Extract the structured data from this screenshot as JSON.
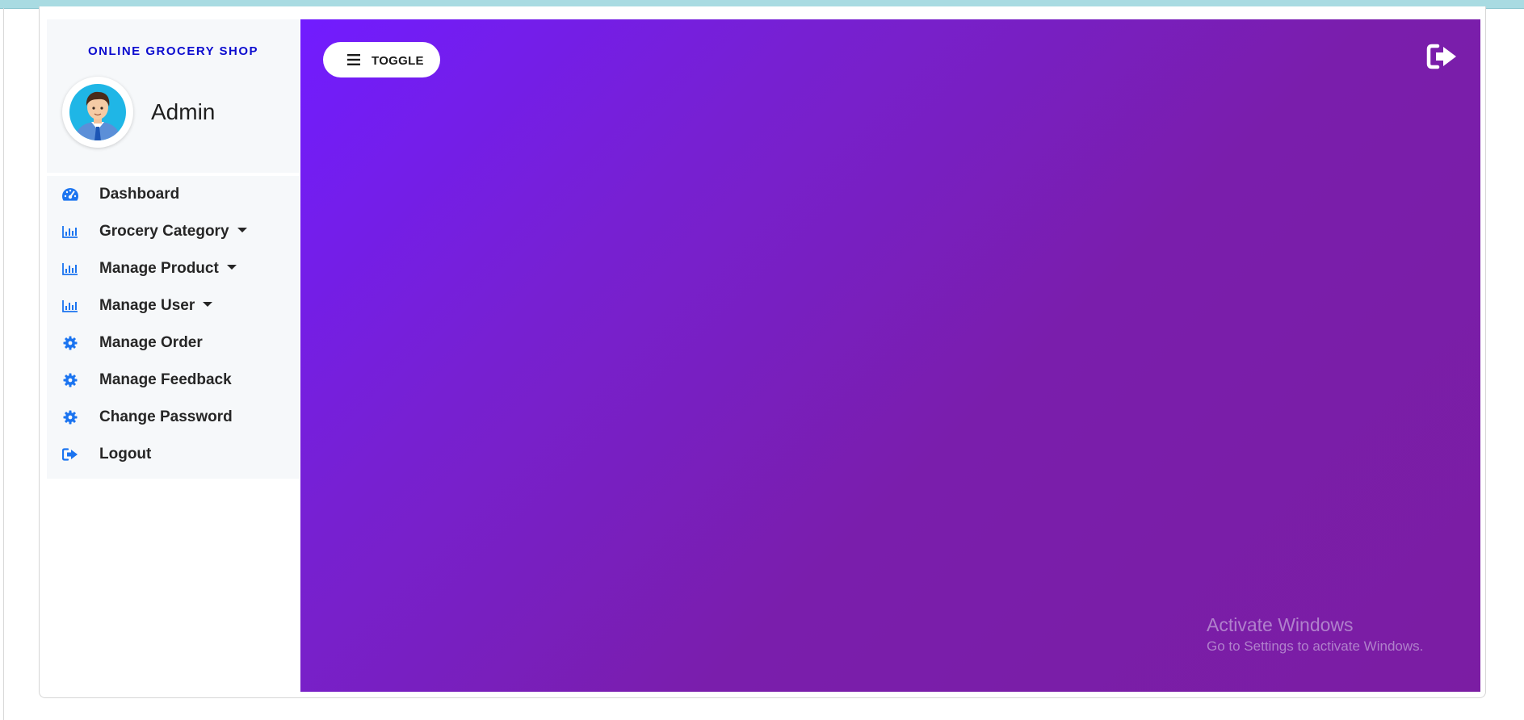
{
  "sidebar": {
    "shop_title": "ONLINE GROCERY SHOP",
    "admin_name": "Admin",
    "items": [
      {
        "label": "Dashboard",
        "icon": "dashboard-gauge-icon",
        "has_dropdown": false
      },
      {
        "label": "Grocery Category",
        "icon": "bar-chart-icon",
        "has_dropdown": true
      },
      {
        "label": "Manage Product",
        "icon": "bar-chart-icon",
        "has_dropdown": true
      },
      {
        "label": "Manage User",
        "icon": "bar-chart-icon",
        "has_dropdown": true
      },
      {
        "label": "Manage Order",
        "icon": "gear-icon",
        "has_dropdown": false
      },
      {
        "label": "Manage Feedback",
        "icon": "gear-icon",
        "has_dropdown": false
      },
      {
        "label": "Change Password",
        "icon": "gear-icon",
        "has_dropdown": false
      },
      {
        "label": "Logout",
        "icon": "sign-out-icon",
        "has_dropdown": false
      }
    ]
  },
  "header": {
    "toggle_label": "TOGGLE",
    "logout_icon": "sign-out-icon"
  },
  "watermark": {
    "title": "Activate Windows",
    "subtitle": "Go to Settings to activate Windows."
  },
  "colors": {
    "accent_blue": "#1b74f0",
    "shop_title_blue": "#0c0ccf",
    "main_gradient_start": "#711cff",
    "main_gradient_end": "#7b1da3",
    "sidebar_bg": "#f6f8fa"
  }
}
